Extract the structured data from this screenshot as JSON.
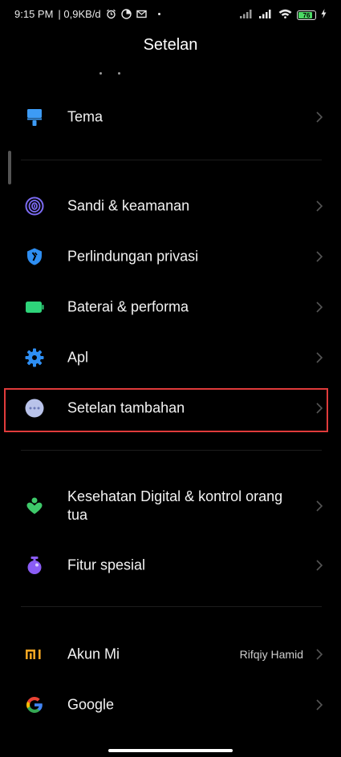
{
  "status_bar": {
    "time": "9:15 PM",
    "network_speed": "| 0,9KB/d",
    "battery_level": "76",
    "icons": [
      "alarm-icon",
      "pie-icon",
      "mail-icon",
      "dot-icon",
      "signal-icon",
      "signal-icon",
      "wifi-icon",
      "battery-icon",
      "charging-icon"
    ]
  },
  "header": {
    "title": "Setelan"
  },
  "items": {
    "tema": {
      "label": "Tema",
      "icon": "brush-icon",
      "color": "#3d9bf5"
    },
    "sandi": {
      "label": "Sandi & keamanan",
      "icon": "fingerprint-icon",
      "color": "#7b6bf2"
    },
    "privasi": {
      "label": "Perlindungan privasi",
      "icon": "shield-icon",
      "color": "#2e8ef2"
    },
    "baterai": {
      "label": "Baterai & performa",
      "icon": "battery-icon",
      "color": "#2ed47a"
    },
    "apl": {
      "label": "Apl",
      "icon": "gear-icon",
      "color": "#2e8ef2"
    },
    "tambahan": {
      "label": "Setelan tambahan",
      "icon": "more-icon",
      "color": "#b9c3ea"
    },
    "kesehatan": {
      "label": "Kesehatan Digital & kontrol orang tua",
      "icon": "wellbeing-icon",
      "color": "#3ec96a"
    },
    "fitur": {
      "label": "Fitur spesial",
      "icon": "special-feature-icon",
      "color": "#8a5cf5"
    },
    "akun": {
      "label": "Akun Mi",
      "value": "Rifqiy Hamid",
      "icon": "mi-logo-icon",
      "color": "#f5a623"
    },
    "google": {
      "label": "Google",
      "icon": "google-icon"
    }
  },
  "colors": {
    "background": "#000000",
    "text": "#f2f2f2",
    "highlight_border": "#e03b3b",
    "chevron": "#555555"
  }
}
